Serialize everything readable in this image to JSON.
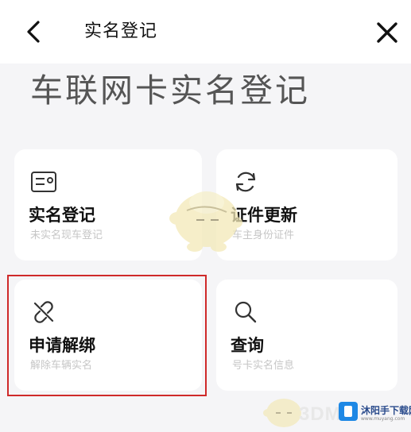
{
  "header": {
    "title": "实名登记",
    "back_icon": "chevron-left-icon",
    "close_icon": "close-icon"
  },
  "page_title": "车联网卡实名登记",
  "cards": [
    {
      "label": "实名登记",
      "subtitle": "未实名现车登记",
      "icon": "id-card-icon"
    },
    {
      "label": "证件更新",
      "subtitle": "车主身份证件",
      "icon": "refresh-icon"
    },
    {
      "label": "申请解绑",
      "subtitle": "解除车辆实名",
      "icon": "unlink-icon"
    },
    {
      "label": "查询",
      "subtitle": "号卡实名信息",
      "icon": "search-icon"
    }
  ],
  "highlight_color": "#cf2a2a",
  "watermark": {
    "brand": "3DM",
    "site_name": "沐阳手下载网",
    "site_url": "www.muyang.com"
  }
}
